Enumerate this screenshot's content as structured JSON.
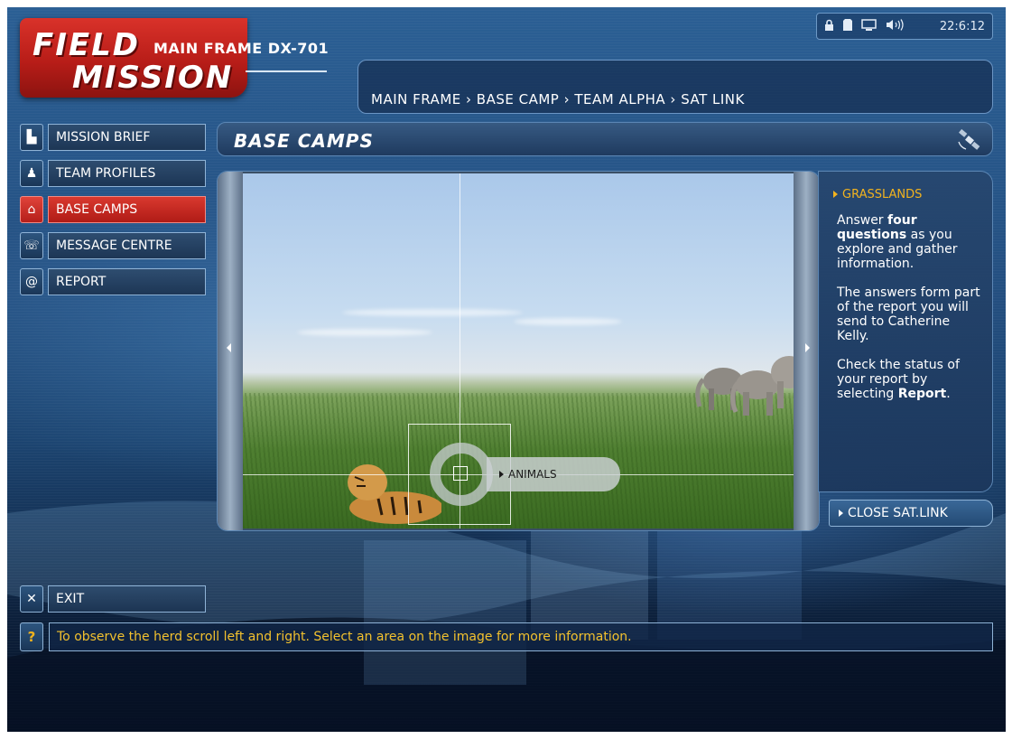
{
  "logo": {
    "line1": "FIELD",
    "line2": "MISSION",
    "subtitle": "MAIN FRAME DX-701"
  },
  "statusbar": {
    "icons": [
      "lock-icon",
      "battery-icon",
      "monitor-icon",
      "volume-icon"
    ],
    "clock": "22:6:12"
  },
  "breadcrumb": "MAIN FRAME › BASE CAMP › TEAM ALPHA › SAT LINK",
  "nav": {
    "items": [
      {
        "label": "MISSION BRIEF",
        "icon": "document-icon",
        "glyph": "▙"
      },
      {
        "label": "TEAM PROFILES",
        "icon": "person-icon",
        "glyph": "♟"
      },
      {
        "label": "BASE CAMPS",
        "icon": "home-icon",
        "glyph": "⌂",
        "active": true
      },
      {
        "label": "MESSAGE CENTRE",
        "icon": "phone-icon",
        "glyph": "☏"
      },
      {
        "label": "REPORT",
        "icon": "at-icon",
        "glyph": "@"
      }
    ]
  },
  "section": {
    "title": "BASE CAMPS"
  },
  "viewer": {
    "hotspot_label": "ANIMALS"
  },
  "info": {
    "heading": "GRASSLANDS",
    "p1_a": "Answer ",
    "p1_b": "four questions",
    "p1_c": " as you explore and gather information.",
    "p2": "The answers form part of the report you will send to Catherine Kelly.",
    "p3_a": "Check the status of your report by selecting ",
    "p3_b": "Report",
    "p3_c": "."
  },
  "close_label": "CLOSE SAT.LINK",
  "exit": {
    "label": "EXIT",
    "glyph": "✕"
  },
  "help": {
    "glyph": "?",
    "text": "To observe the herd scroll left and right.  Select an area on the image for more information."
  },
  "colors": {
    "accent_red": "#d9392f",
    "highlight_yellow": "#f2b31e",
    "panel_border": "#8fb3d6"
  }
}
